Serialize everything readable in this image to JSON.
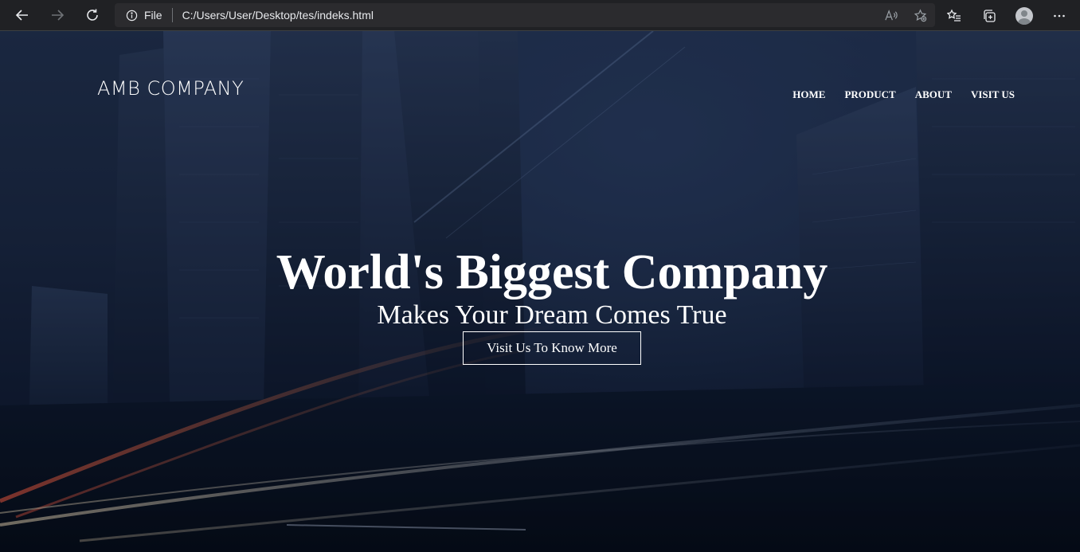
{
  "browser": {
    "site_info_label": "File",
    "url": "C:/Users/User/Desktop/tes/indeks.html"
  },
  "page": {
    "brand": "AMB COMPANY",
    "nav": [
      "HOME",
      "PRODUCT",
      "ABOUT",
      "VISIT US"
    ],
    "headline": "World's Biggest Company",
    "subline": "Makes Your Dream Comes True",
    "cta": "Visit Us To Know More"
  },
  "colors": {
    "chrome_bg": "#202124",
    "address_bg": "#2b2b2e",
    "hero_tint": "#1c2740",
    "text": "#ffffff"
  }
}
